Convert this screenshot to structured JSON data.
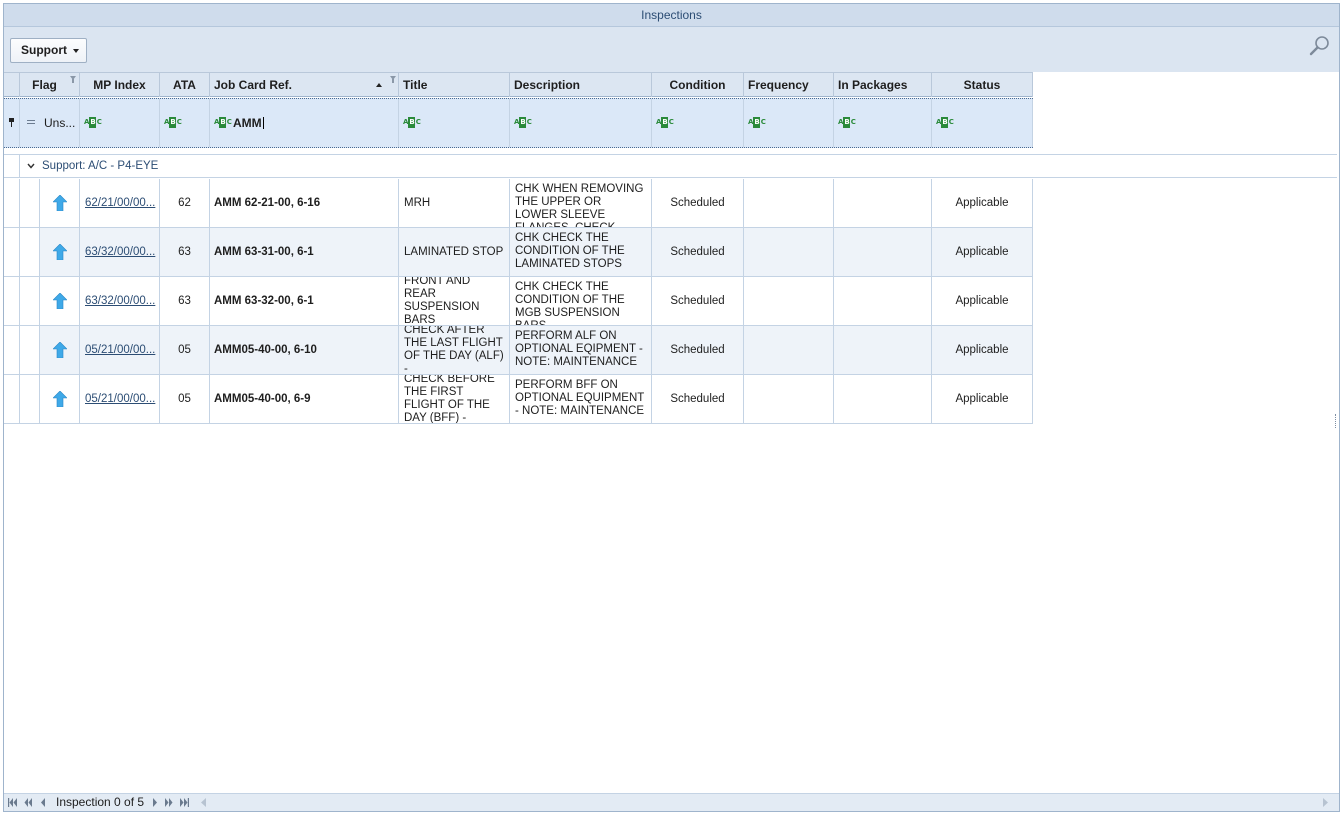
{
  "window": {
    "title": "Inspections"
  },
  "toolbar": {
    "support_label": "Support",
    "search_icon": "search-icon"
  },
  "columns": {
    "flag": "Flag",
    "mp_index": "MP Index",
    "ata": "ATA",
    "job_card": "Job Card Ref.",
    "title": "Title",
    "description": "Description",
    "condition": "Condition",
    "frequency": "Frequency",
    "in_packages": "In Packages",
    "status": "Status"
  },
  "filter_row": {
    "flag_value": "Uns...",
    "job_card_value": "AMM"
  },
  "group": {
    "label": "Support: A/C - P4-EYE"
  },
  "rows": [
    {
      "mp_index": "62/21/00/00...",
      "ata": "62",
      "job_card": "AMM 62-21-00, 6-16",
      "title": "MRH",
      "description": "CHK WHEN REMOVING THE UPPER OR LOWER SLEEVE FLANGES, CHECK",
      "condition": "Scheduled",
      "frequency": "",
      "in_packages": "",
      "status": "Applicable"
    },
    {
      "mp_index": "63/32/00/00...",
      "ata": "63",
      "job_card": "AMM 63-31-00, 6-1",
      "title": "LAMINATED STOP",
      "description": "CHK CHECK THE CONDITION OF THE LAMINATED STOPS",
      "condition": "Scheduled",
      "frequency": "",
      "in_packages": "",
      "status": "Applicable"
    },
    {
      "mp_index": "63/32/00/00...",
      "ata": "63",
      "job_card": "AMM 63-32-00, 6-1",
      "title": "FRONT AND REAR SUSPENSION BARS",
      "description": "CHK CHECK THE CONDITION OF THE MGB SUSPENSION BARS",
      "condition": "Scheduled",
      "frequency": "",
      "in_packages": "",
      "status": "Applicable"
    },
    {
      "mp_index": "05/21/00/00...",
      "ata": "05",
      "job_card": "AMM05-40-00, 6-10",
      "title": "CHECK AFTER THE LAST FLIGHT OF THE DAY (ALF) -",
      "description": "PERFORM ALF ON OPTIONAL EQIPMENT - NOTE: MAINTENANCE",
      "condition": "Scheduled",
      "frequency": "",
      "in_packages": "",
      "status": "Applicable"
    },
    {
      "mp_index": "05/21/00/00...",
      "ata": "05",
      "job_card": "AMM05-40-00, 6-9",
      "title": "CHECK BEFORE THE FIRST FLIGHT OF THE DAY (BFF) -",
      "description": "PERFORM  BFF ON OPTIONAL EQUIPMENT - NOTE: MAINTENANCE",
      "condition": "Scheduled",
      "frequency": "",
      "in_packages": "",
      "status": "Applicable"
    }
  ],
  "footer": {
    "record_text": "Inspection 0 of 5"
  },
  "colors": {
    "accent": "#2c4d74",
    "header_bg": "#dce6f2",
    "filter_bg": "#dbe8f8",
    "arrow": "#3fa9e8"
  }
}
